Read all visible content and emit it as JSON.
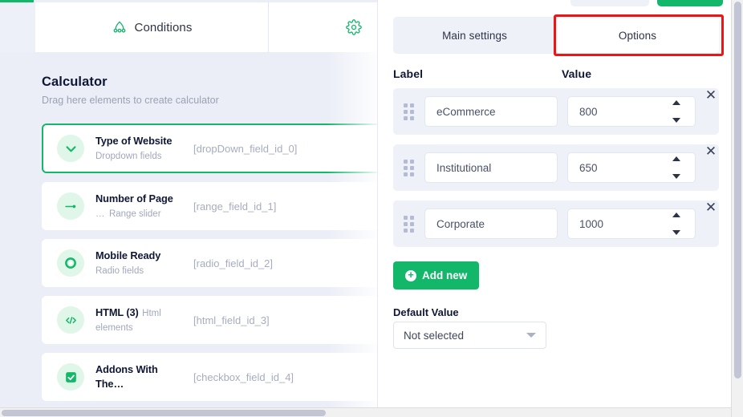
{
  "builder": {
    "top_tabs": [
      {
        "label": "Conditions",
        "icon": "conditions-icon"
      },
      {
        "label": "",
        "icon": "gear-icon"
      }
    ],
    "canvas": {
      "title": "Calculator",
      "subtitle": "Drag here elements to create calculator"
    },
    "fields": [
      {
        "name": "Type of Website",
        "type": "Dropdown fields",
        "id": "[dropDown_field_id_0]",
        "icon": "chevron-down-icon",
        "selected": true,
        "ellipsis": false
      },
      {
        "name": "Number of Page",
        "type": "Range slider",
        "id": "[range_field_id_1]",
        "icon": "range-slider-icon",
        "selected": false,
        "ellipsis": true
      },
      {
        "name": "Mobile Ready",
        "type": "Radio fields",
        "id": "[radio_field_id_2]",
        "icon": "radio-icon",
        "selected": false,
        "ellipsis": false
      },
      {
        "name": "HTML (3)",
        "type": "Html elements",
        "id": "[html_field_id_3]",
        "icon": "code-icon",
        "selected": false,
        "ellipsis": false
      },
      {
        "name": "Addons With The…",
        "type": "",
        "id": "[checkbox_field_id_4]",
        "icon": "checkbox-icon",
        "selected": false,
        "ellipsis": false
      }
    ]
  },
  "panel": {
    "tabs": [
      {
        "label": "Main settings",
        "active": false
      },
      {
        "label": "Options",
        "active": true
      }
    ],
    "columns": {
      "label": "Label",
      "value": "Value"
    },
    "options": [
      {
        "label": "eCommerce",
        "value": "800",
        "remove_icon": "close-icon"
      },
      {
        "label": "Institutional",
        "value": "650",
        "remove_icon": "close-icon"
      },
      {
        "label": "Corporate",
        "value": "1000",
        "remove_icon": "close-icon"
      }
    ],
    "add_new": {
      "label": "Add new",
      "icon": "plus-circle-icon"
    },
    "default_value": {
      "label": "Default Value",
      "selected": "Not selected",
      "icon": "chevron-down-icon"
    }
  },
  "colors": {
    "accent_green": "#12b76a",
    "highlight_red": "#ef1414",
    "panel_bg": "#ffffff",
    "canvas_bg": "#ebeef7",
    "row_bg": "#eef1f8",
    "text_dark": "#101735",
    "text_muted": "#a2a8bb"
  }
}
